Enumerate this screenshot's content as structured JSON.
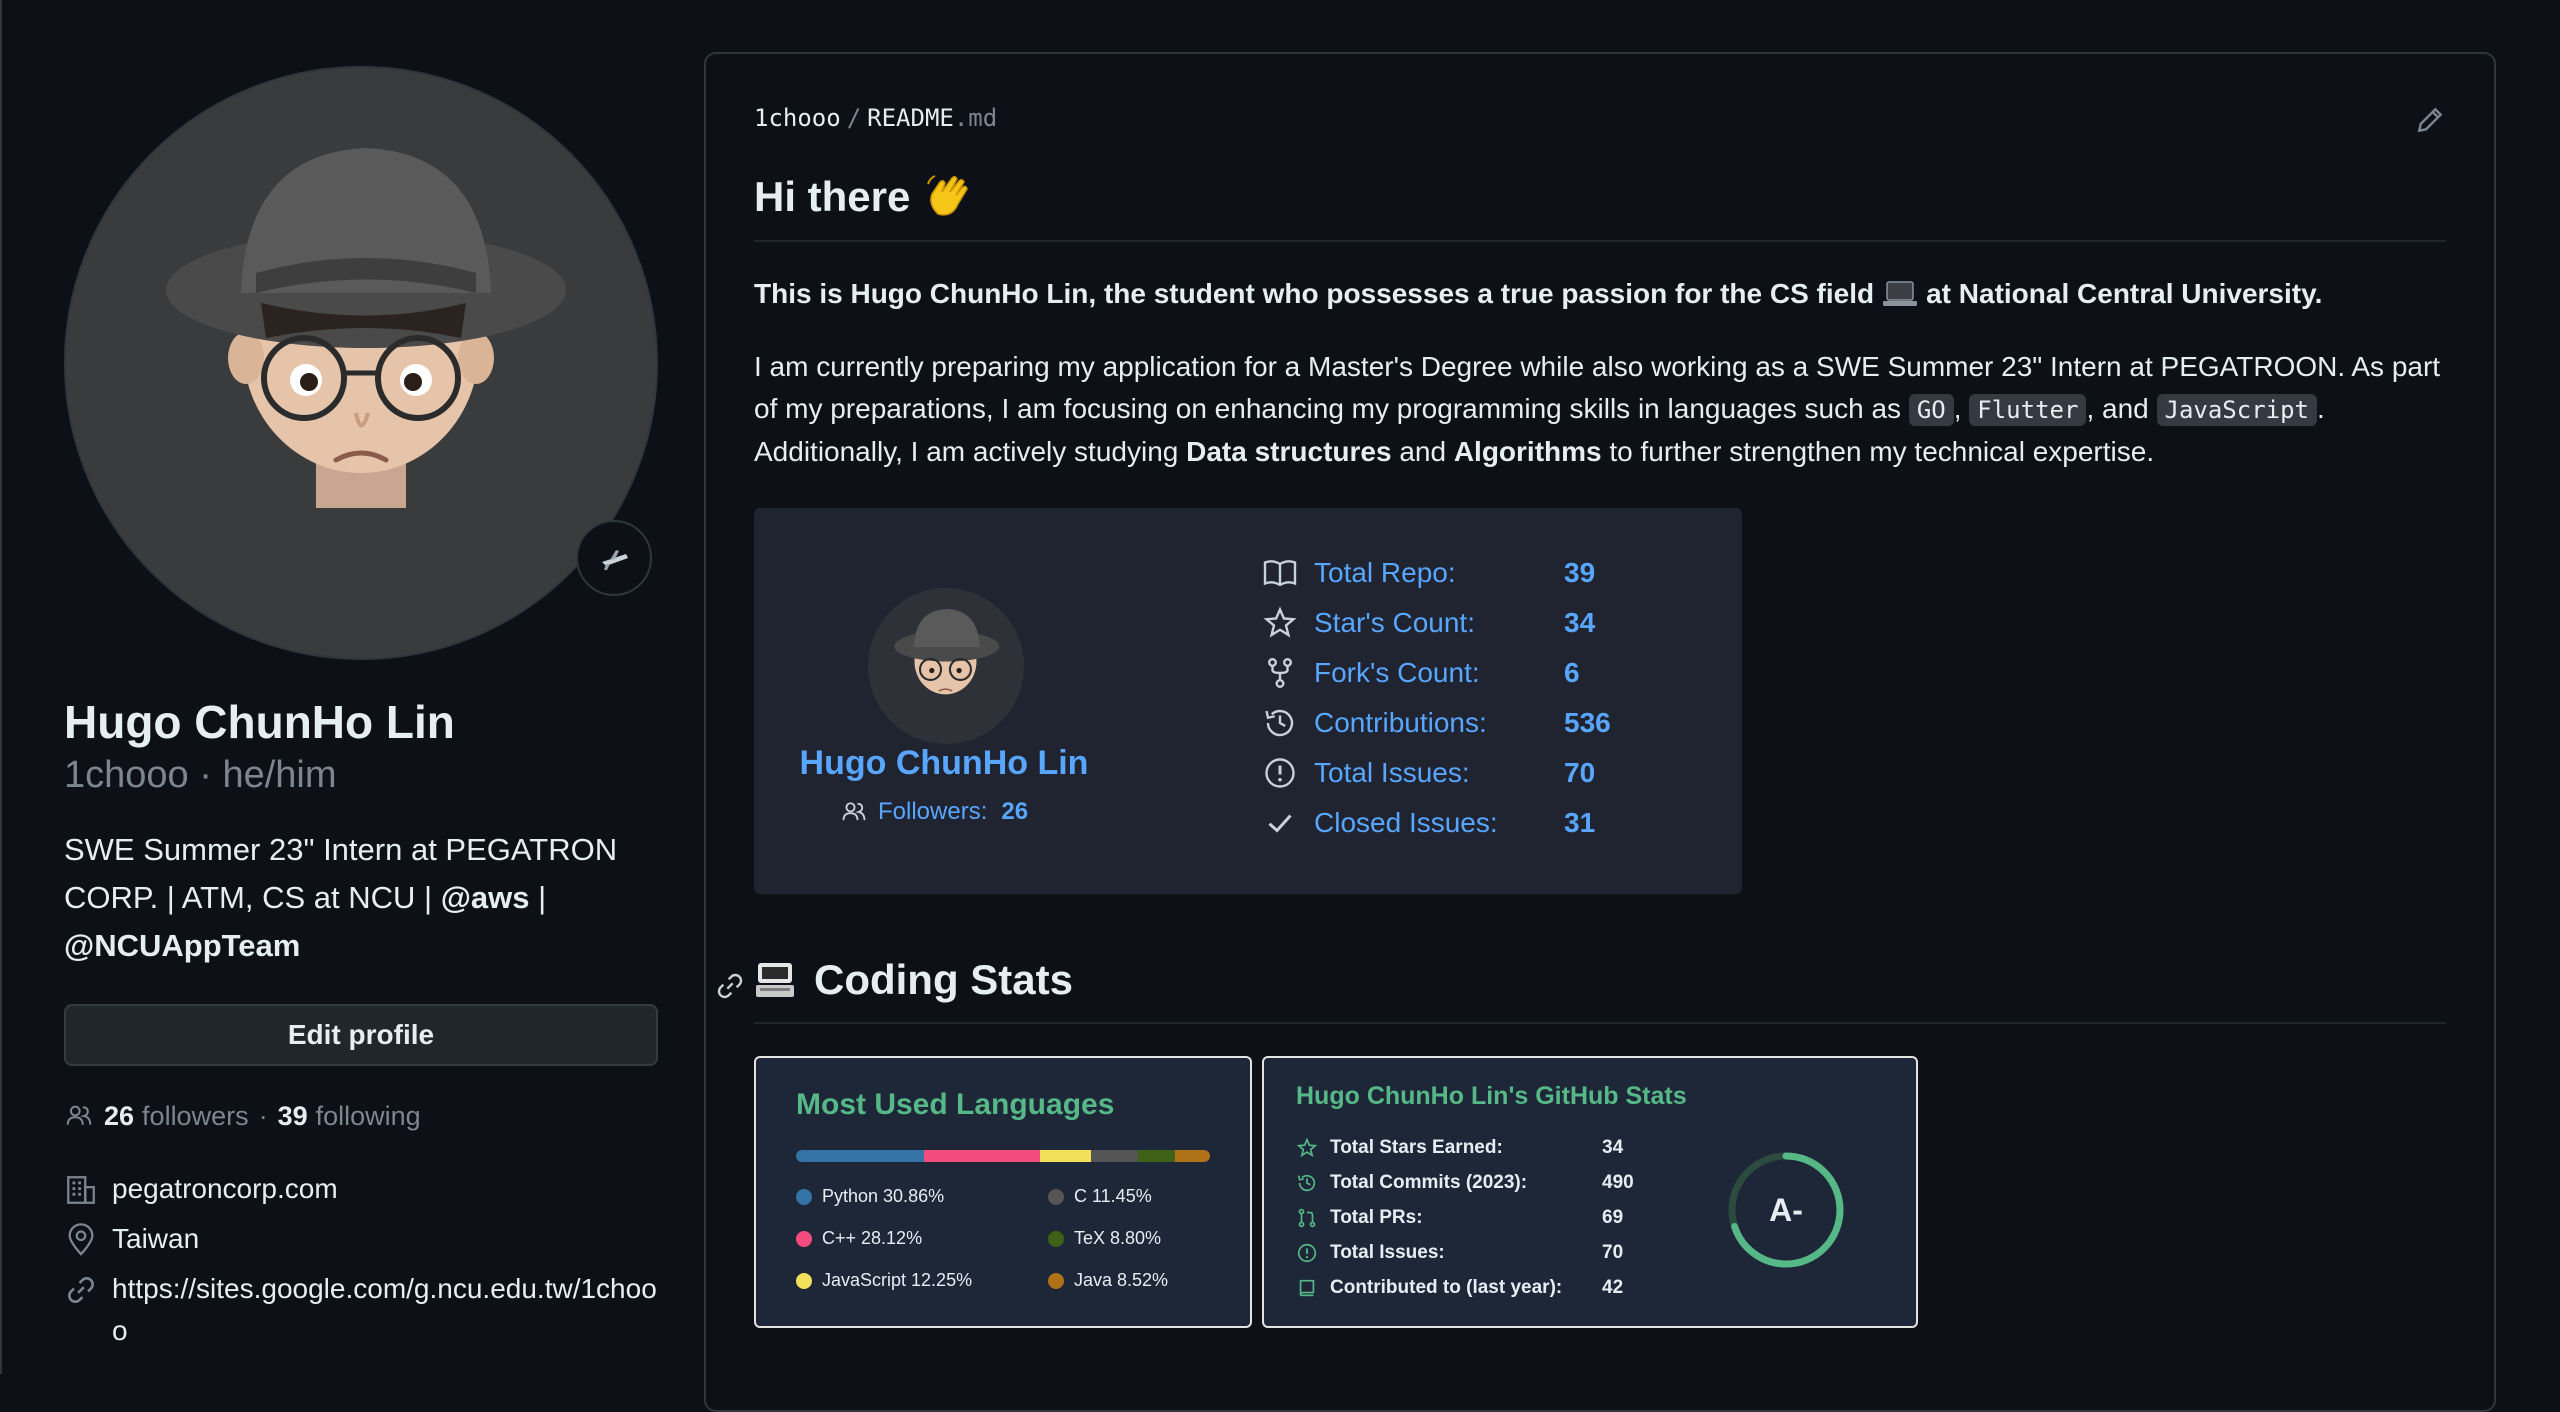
{
  "profile": {
    "name": "Hugo ChunHo Lin",
    "handle": "1chooo · he/him",
    "bio_text": "SWE Summer 23\" Intern at PEGATRON CORP. | ATM, CS at NCU | ",
    "bio_mention_aws": "@aws",
    "bio_sep": " | ",
    "bio_mention_team": "@NCUAppTeam",
    "edit_label": "Edit profile",
    "followers_count": "26",
    "followers_label": "followers",
    "dot": "·",
    "following_count": "39",
    "following_label": "following",
    "company": "pegatroncorp.com",
    "location": "Taiwan",
    "website": "https://sites.google.com/g.ncu.edu.tw/1chooo"
  },
  "readme": {
    "owner": "1chooo",
    "sep": "/",
    "file": "README",
    "ext": ".md",
    "heading": "Hi there",
    "intro_a": "This is Hugo ChunHo Lin, the student who possesses a true passion for the CS field",
    "intro_b": "at National Central University.",
    "para_1": "I am currently preparing my application for a Master's Degree while also working as a SWE Summer 23\" Intern at PEGATROON. As part of my preparations, I am focusing on enhancing my programming skills in languages such as ",
    "code_go": "GO",
    "comma": ", ",
    "code_flutter": "Flutter",
    "and": ", and ",
    "code_js": "JavaScript",
    "para_2": ". Additionally, I am actively studying ",
    "bold_ds": "Data structures",
    "and2": " and ",
    "bold_algo": "Algorithms",
    "para_3": " to further strengthen my technical expertise."
  },
  "stats_card": {
    "name": "Hugo ChunHo Lin",
    "followers_label": "Followers:",
    "followers_value": "26",
    "rows": [
      {
        "label": "Total Repo:",
        "value": "39",
        "icon": "book-icon"
      },
      {
        "label": "Star's Count:",
        "value": "34",
        "icon": "star-icon"
      },
      {
        "label": "Fork's Count:",
        "value": "6",
        "icon": "fork-icon"
      },
      {
        "label": "Contributions:",
        "value": "536",
        "icon": "history-icon"
      },
      {
        "label": "Total Issues:",
        "value": "70",
        "icon": "issue-icon"
      },
      {
        "label": "Closed Issues:",
        "value": "31",
        "icon": "check-icon"
      }
    ],
    "accent": "#58a6ff"
  },
  "coding_stats": {
    "heading": "Coding Stats",
    "languages": {
      "title": "Most Used Languages",
      "items": [
        {
          "name": "Python",
          "percent": 30.86,
          "label": "Python 30.86%",
          "color": "#3572A5"
        },
        {
          "name": "C++",
          "percent": 28.12,
          "label": "C++ 28.12%",
          "color": "#f34b7d"
        },
        {
          "name": "JavaScript",
          "percent": 12.25,
          "label": "JavaScript 12.25%",
          "color": "#f1e05a"
        },
        {
          "name": "C",
          "percent": 11.45,
          "label": "C 11.45%",
          "color": "#555555"
        },
        {
          "name": "TeX",
          "percent": 8.8,
          "label": "TeX 8.80%",
          "color": "#3D6117"
        },
        {
          "name": "Java",
          "percent": 8.52,
          "label": "Java 8.52%",
          "color": "#b07219"
        }
      ]
    },
    "github": {
      "title": "Hugo ChunHo Lin's GitHub Stats",
      "rows": [
        {
          "label": "Total Stars Earned:",
          "value": "34"
        },
        {
          "label": "Total Commits (2023):",
          "value": "490"
        },
        {
          "label": "Total PRs:",
          "value": "69"
        },
        {
          "label": "Total Issues:",
          "value": "70"
        },
        {
          "label": "Contributed to (last year):",
          "value": "42"
        }
      ],
      "rank": "A-",
      "rank_progress": 0.7,
      "accent": "#56b886"
    }
  }
}
